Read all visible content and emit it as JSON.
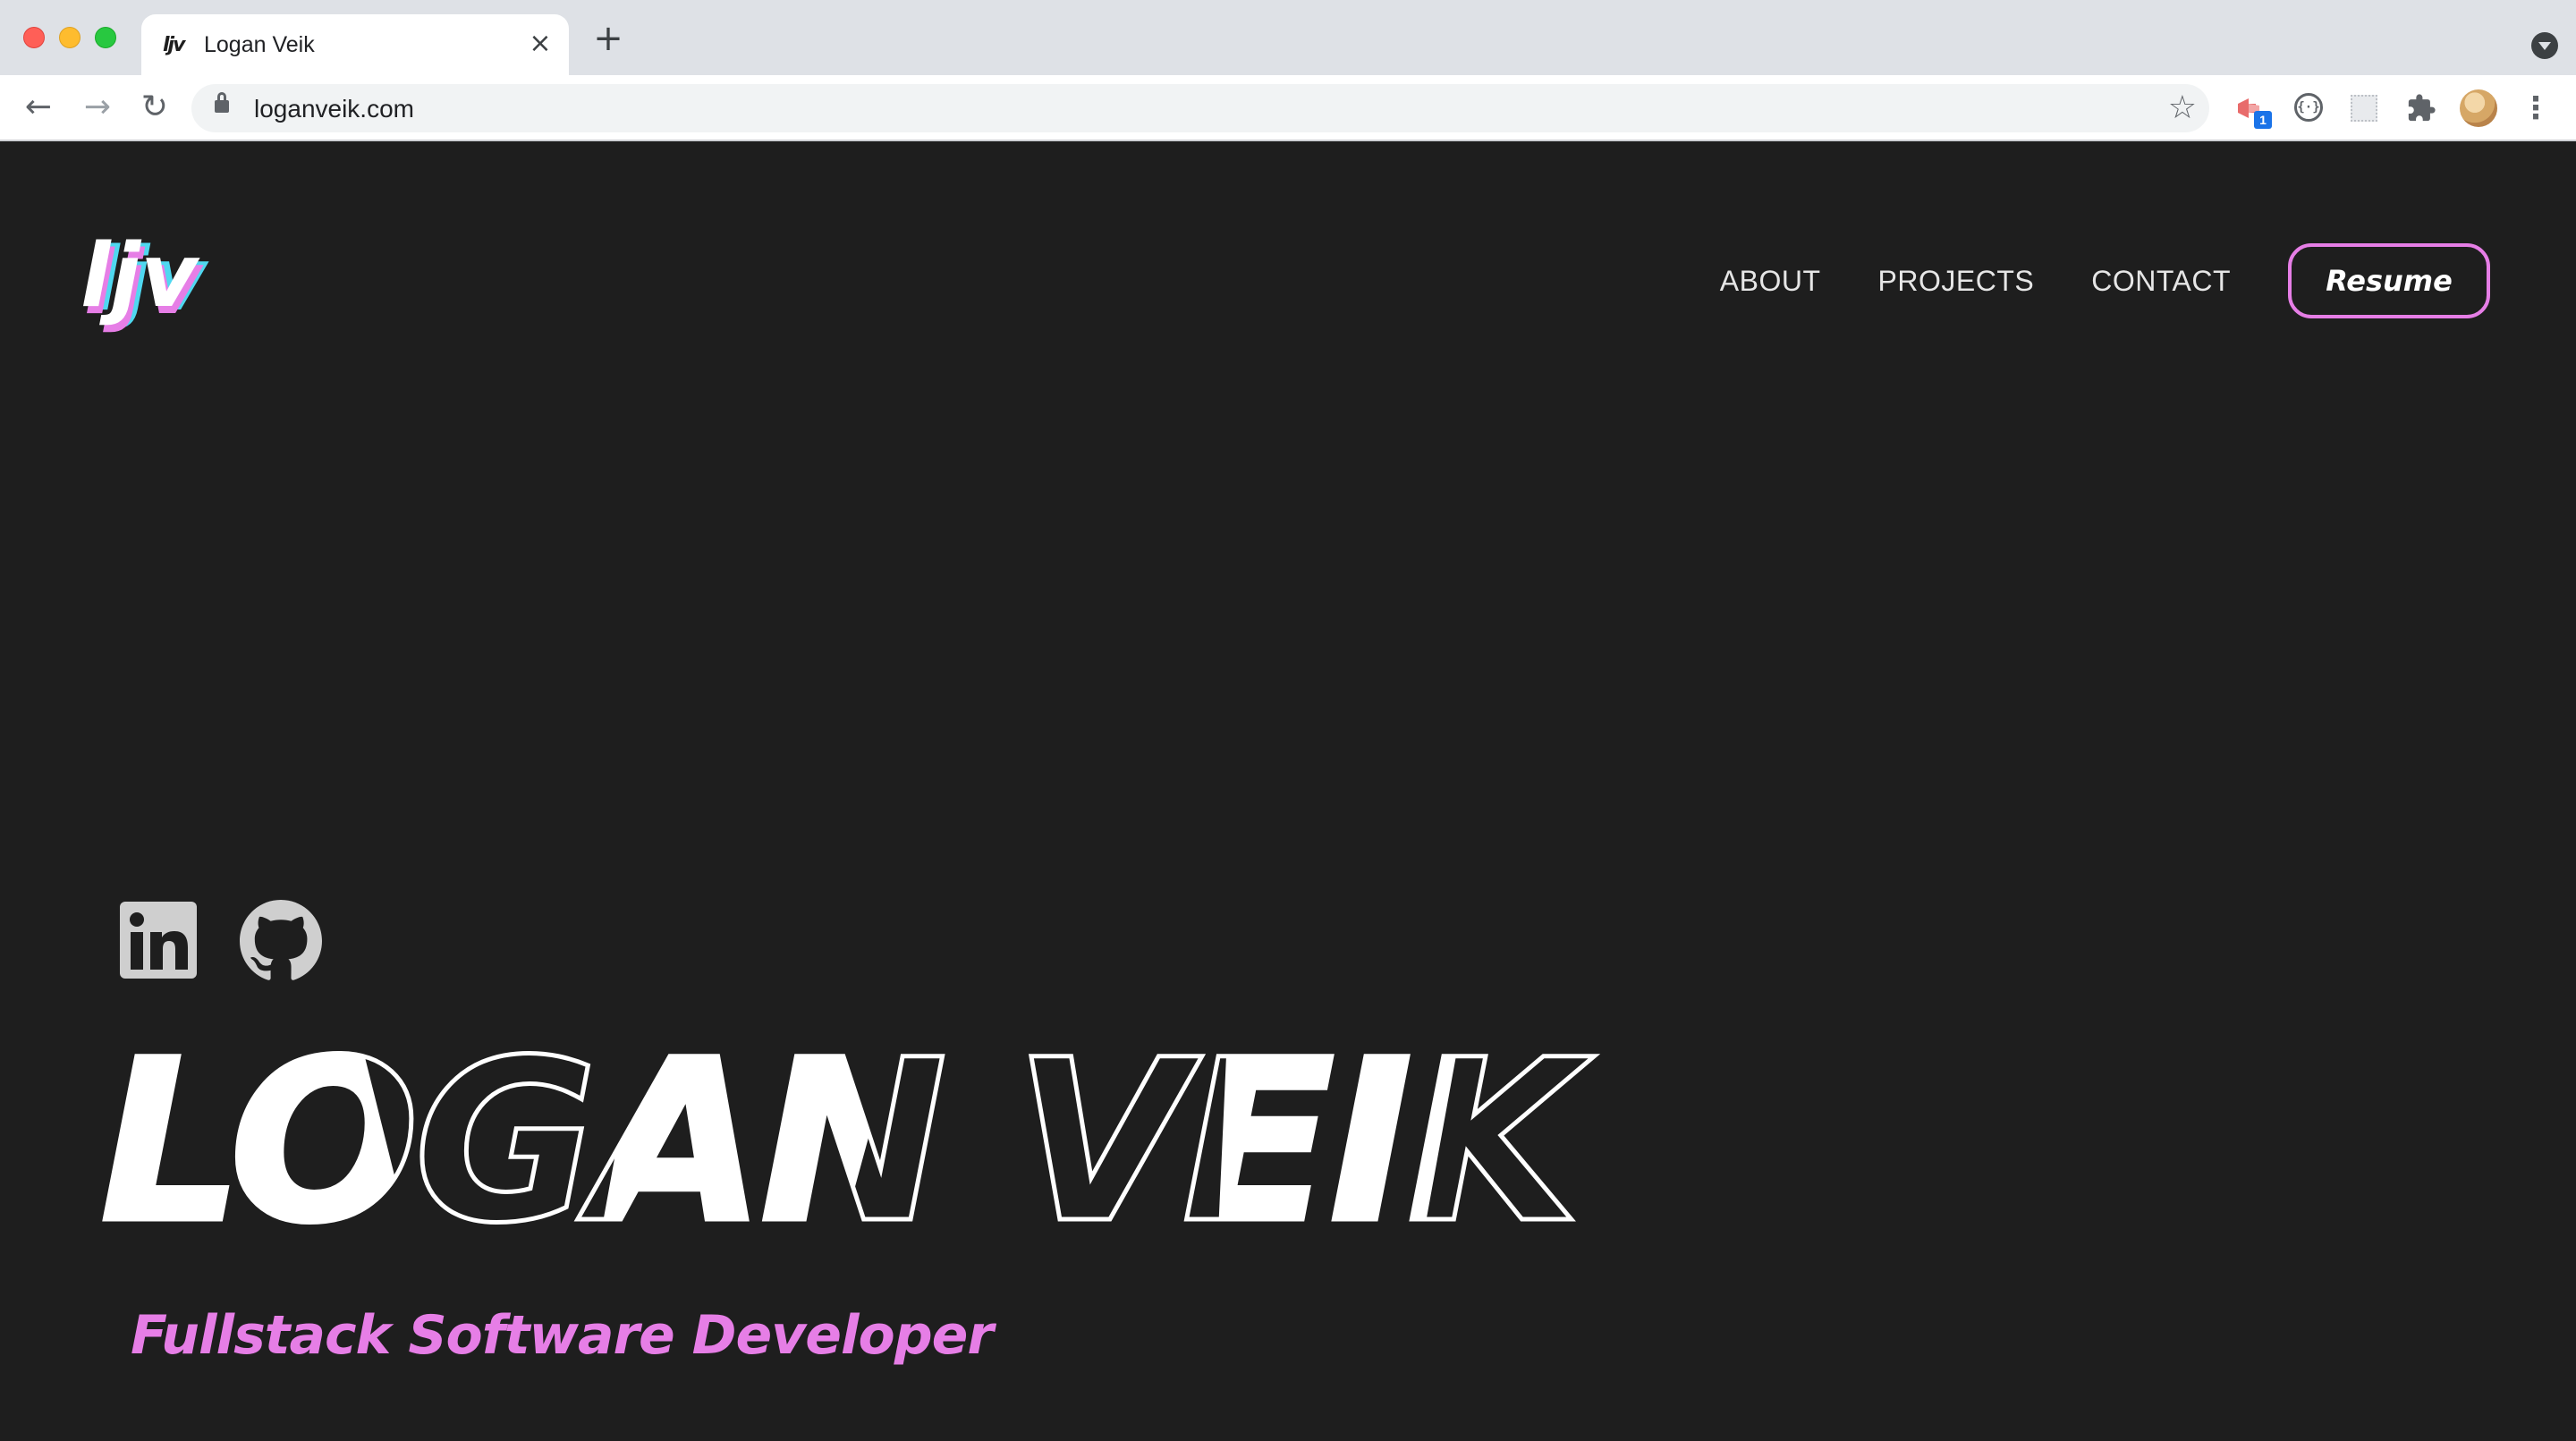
{
  "browser": {
    "tab": {
      "favicon_text": "ljv",
      "title": "Logan Veik",
      "close_glyph": "×"
    },
    "new_tab_glyph": "+",
    "url": "loganveik.com",
    "nav_glyphs": {
      "back": "←",
      "forward": "→",
      "reload": "↻"
    },
    "star_glyph": "☆",
    "extension_badge": "1",
    "menu_glyph": "⋮"
  },
  "site": {
    "logo_text": "ljv",
    "nav": [
      {
        "label": "ABOUT"
      },
      {
        "label": "PROJECTS"
      },
      {
        "label": "CONTACT"
      }
    ],
    "resume_label": "Resume",
    "social": [
      {
        "icon": "linkedin-icon"
      },
      {
        "icon": "github-icon"
      }
    ],
    "hero_name": "LOGAN VEIK",
    "tagline": "Fullstack Software Developer",
    "colors": {
      "background": "#1e1e1e",
      "accent_pink": "#e67ee6",
      "accent_cyan": "#4fd8f0",
      "text": "#ffffff",
      "icon_gray": "#cfcfcf"
    }
  }
}
